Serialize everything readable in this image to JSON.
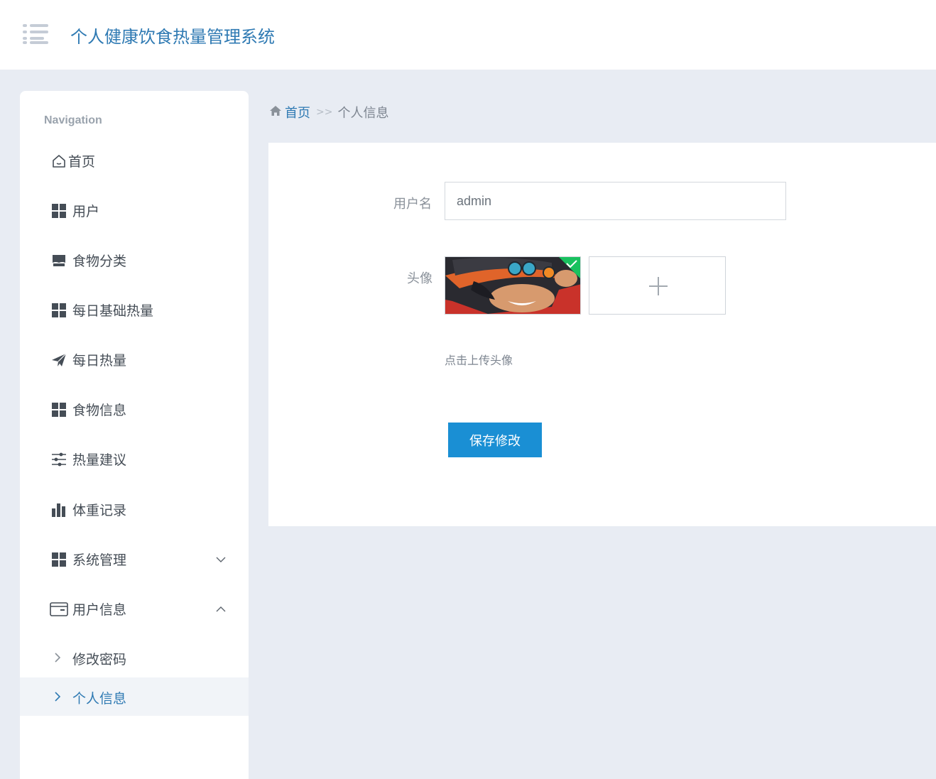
{
  "header": {
    "title": "个人健康饮食热量管理系统",
    "menu_icon": "list-menu-icon"
  },
  "sidebar": {
    "heading": "Navigation",
    "items": [
      {
        "label": "首页",
        "icon": "home-icon"
      },
      {
        "label": "用户",
        "icon": "grid-icon"
      },
      {
        "label": "食物分类",
        "icon": "store-icon"
      },
      {
        "label": "每日基础热量",
        "icon": "grid-icon"
      },
      {
        "label": "每日热量",
        "icon": "paper-plane-icon"
      },
      {
        "label": "食物信息",
        "icon": "grid-icon"
      },
      {
        "label": "热量建议",
        "icon": "sliders-icon"
      },
      {
        "label": "体重记录",
        "icon": "bar-chart-icon"
      },
      {
        "label": "系统管理",
        "icon": "grid-icon",
        "expanded": false
      },
      {
        "label": "用户信息",
        "icon": "wallet-icon",
        "expanded": true
      }
    ],
    "sub_items": [
      {
        "label": "修改密码",
        "active": false
      },
      {
        "label": "个人信息",
        "active": true
      }
    ]
  },
  "breadcrumb": {
    "home": "首页",
    "separator": ">>",
    "current": "个人信息"
  },
  "form": {
    "username_label": "用户名",
    "username_value": "admin",
    "avatar_label": "头像",
    "upload_hint": "点击上传头像",
    "save_label": "保存修改"
  },
  "colors": {
    "accent": "#2f7ab3",
    "button": "#1a8fd4",
    "background": "#e8ecf3",
    "active_bg": "#f1f4f8"
  }
}
